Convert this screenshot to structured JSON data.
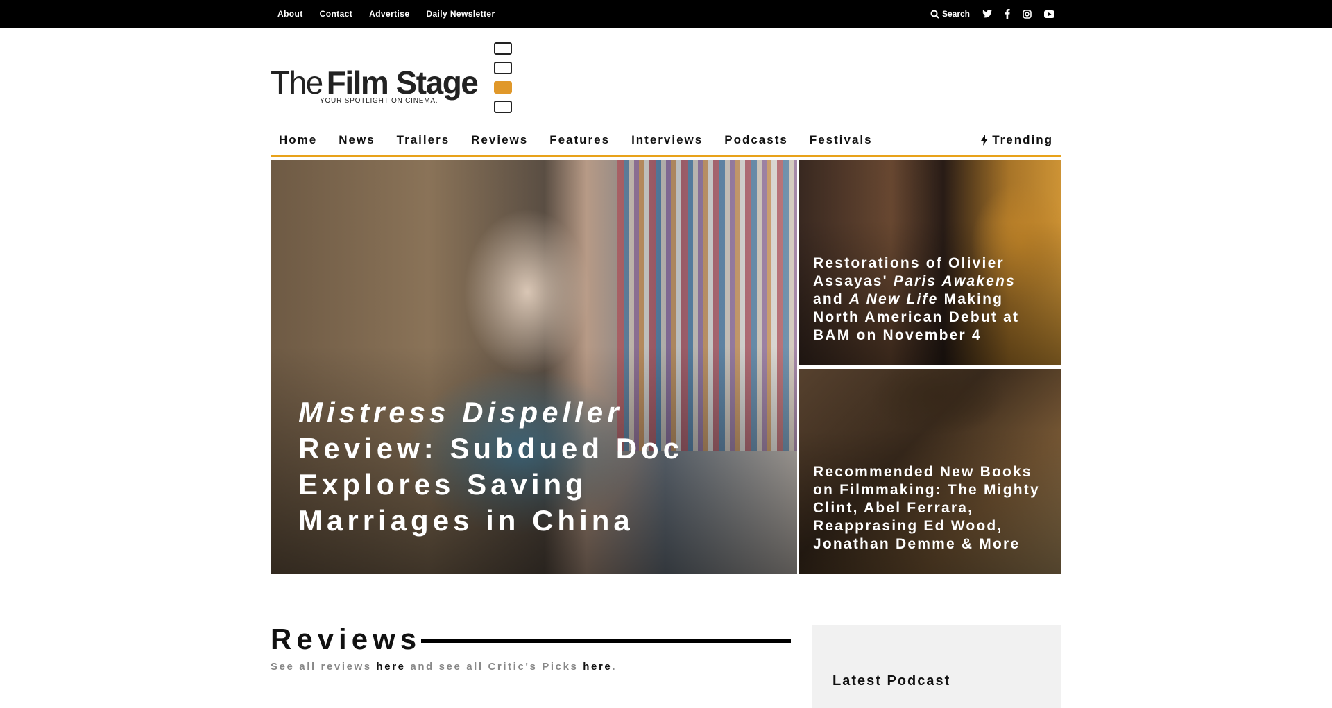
{
  "topbar": {
    "links": [
      "About",
      "Contact",
      "Advertise",
      "Daily Newsletter"
    ],
    "search_label": "Search",
    "social_icons": [
      "twitter-icon",
      "facebook-icon",
      "instagram-icon",
      "youtube-icon"
    ]
  },
  "logo": {
    "the": "The",
    "film_stage": "Film Stage",
    "tagline": "YOUR SPOTLIGHT ON CINEMA."
  },
  "nav": {
    "items": [
      "Home",
      "News",
      "Trailers",
      "Reviews",
      "Features",
      "Interviews",
      "Podcasts",
      "Festivals"
    ],
    "trending": "Trending"
  },
  "hero": {
    "main": {
      "title_italic": "Mistress Dispeller",
      "title_rest": " Review: Subdued Doc Explores Saving Marriages in China"
    },
    "side_a": {
      "part1": "Restorations of Olivier Assayas' ",
      "italic1": "Paris Awakens",
      "part2": " and ",
      "italic2": "A New Life",
      "part3": " Making North American Debut at BAM on November 4"
    },
    "side_b": {
      "title": "Recommended New Books on Filmmaking: The Mighty Clint, Abel Ferrara, Reapprasing Ed Wood, Jonathan Demme & More"
    }
  },
  "reviews": {
    "heading": "Reviews",
    "sub_prefix": "See all reviews ",
    "sub_link1": "here",
    "sub_middle": " and see all Critic's Picks ",
    "sub_link2": "here",
    "sub_suffix": "."
  },
  "sidebar": {
    "heading": "Latest Podcast"
  },
  "colors": {
    "accent": "#e8a21a",
    "topbar_bg": "#000000"
  }
}
